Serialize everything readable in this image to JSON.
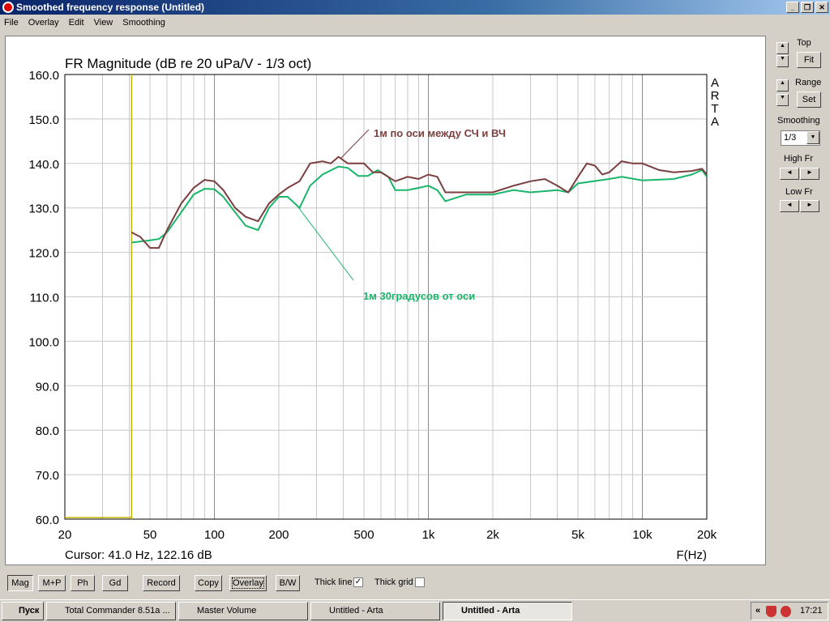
{
  "window": {
    "title": "Smoothed frequency response (Untitled)",
    "min": "_",
    "max": "❐",
    "close": "✕"
  },
  "menu": [
    "File",
    "Overlay",
    "Edit",
    "View",
    "Smoothing"
  ],
  "side": {
    "top_label": "Top",
    "fit": "Fit",
    "range_label": "Range",
    "set": "Set",
    "smoothing_label": "Smoothing",
    "smoothing_value": "1/3",
    "high_label": "High Fr",
    "low_label": "Low Fr",
    "up": "▲",
    "down": "▼",
    "left": "◄",
    "right": "►"
  },
  "toolbar": {
    "mag": "Mag",
    "mp": "M+P",
    "ph": "Ph",
    "gd": "Gd",
    "record": "Record",
    "copy": "Copy",
    "overlay": "Overlay",
    "bw": "B/W",
    "thick_line": "Thick line",
    "thick_line_checked": "✓",
    "thick_grid": "Thick grid"
  },
  "taskbar": {
    "start": "Пуск",
    "tasks": [
      "Total Commander 8.51a ...",
      "Master Volume",
      "Untitled - Arta",
      "Untitled - Arta"
    ],
    "clock": "17:21",
    "chev": "«"
  },
  "chart_data": {
    "type": "line",
    "title": "FR Magnitude (dB re 20 uPa/V - 1/3 oct)",
    "xlabel": "F(Hz)",
    "brand": "ARTA",
    "xscale": "log",
    "xlim": [
      20,
      20000
    ],
    "ylim": [
      60,
      160
    ],
    "yticks": [
      "160.0",
      "150.0",
      "140.0",
      "130.0",
      "120.0",
      "110.0",
      "100.0",
      "90.0",
      "80.0",
      "70.0",
      "60.0"
    ],
    "xticks": [
      {
        "v": 20,
        "l": "20"
      },
      {
        "v": 50,
        "l": "50"
      },
      {
        "v": 100,
        "l": "100"
      },
      {
        "v": 200,
        "l": "200"
      },
      {
        "v": 500,
        "l": "500"
      },
      {
        "v": 1000,
        "l": "1k"
      },
      {
        "v": 2000,
        "l": "2k"
      },
      {
        "v": 5000,
        "l": "5k"
      },
      {
        "v": 10000,
        "l": "10k"
      },
      {
        "v": 20000,
        "l": "20k"
      }
    ],
    "cursor_text": "Cursor: 41.0 Hz, 122.16 dB",
    "cursor_hz": 41,
    "series": [
      {
        "name": "1м по оси между СЧ и ВЧ",
        "color": "#7b3f3f",
        "x": [
          41,
          45,
          50,
          55,
          60,
          70,
          80,
          90,
          100,
          110,
          125,
          140,
          160,
          180,
          200,
          220,
          250,
          280,
          320,
          350,
          380,
          420,
          500,
          550,
          600,
          700,
          800,
          900,
          1000,
          1100,
          1200,
          1500,
          2000,
          2500,
          3000,
          3500,
          4000,
          4500,
          5000,
          5500,
          6000,
          6500,
          7000,
          8000,
          9000,
          10000,
          12000,
          14000,
          17000,
          19000,
          20000
        ],
        "y": [
          124.5,
          123.5,
          121,
          121,
          125,
          131,
          134.5,
          136.3,
          136,
          134,
          130,
          128,
          127,
          131,
          133,
          134.5,
          136,
          140,
          140.5,
          140,
          141.5,
          140,
          140,
          138,
          138,
          136,
          137,
          136.5,
          137.5,
          137,
          133.5,
          133.5,
          133.5,
          135,
          136,
          136.5,
          135,
          133.5,
          137,
          140,
          139.5,
          137.5,
          138,
          140.5,
          140,
          140,
          138.5,
          138,
          138.3,
          138.8,
          137.5
        ]
      },
      {
        "name": "1м  30градусов от оси",
        "color": "#1ab56a",
        "x": [
          41,
          50,
          55,
          60,
          70,
          80,
          90,
          100,
          110,
          125,
          140,
          160,
          180,
          200,
          220,
          250,
          280,
          320,
          380,
          420,
          470,
          520,
          580,
          650,
          700,
          800,
          900,
          1000,
          1100,
          1200,
          1500,
          2000,
          2500,
          3000,
          4000,
          4500,
          5000,
          7000,
          8000,
          10000,
          14000,
          17000,
          19000,
          20000
        ],
        "y": [
          122.2,
          122.7,
          123,
          124.5,
          129,
          133,
          134.3,
          134.2,
          132.5,
          129,
          126,
          125,
          130,
          132.5,
          132.5,
          130,
          135,
          137.5,
          139.3,
          139,
          137.2,
          137.2,
          138.5,
          137,
          134,
          134,
          134.5,
          135,
          134,
          131.5,
          133,
          133,
          134,
          133.5,
          134,
          133.5,
          135.5,
          136.5,
          137,
          136.2,
          136.5,
          137.5,
          138.5,
          137
        ]
      }
    ]
  }
}
